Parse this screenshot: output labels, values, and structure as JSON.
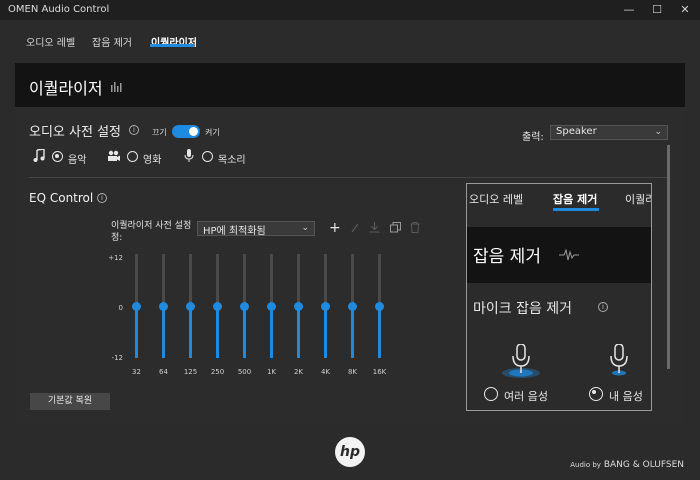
{
  "window": {
    "title": "OMEN Audio Control",
    "min": "—",
    "max": "☐",
    "close": "✕"
  },
  "tabs": [
    {
      "label": "오디오 레벨"
    },
    {
      "label": "잡음 제거"
    },
    {
      "label": "이퀄라이저"
    }
  ],
  "panel": {
    "title": "이퀄라이저"
  },
  "preset": {
    "title": "오디오 사전 설정",
    "off": "끄기",
    "on": "켜기",
    "modes": [
      {
        "label": "음악",
        "selected": true
      },
      {
        "label": "영화",
        "selected": false
      },
      {
        "label": "목소리",
        "selected": false
      }
    ]
  },
  "output": {
    "label": "출력:",
    "value": "Speaker"
  },
  "eq": {
    "title": "EQ Control",
    "preset_label_1": "이퀄라이저 사전 설정",
    "preset_label_2": "정:",
    "preset_value": "HP에 최적화됨",
    "db_max": "+12",
    "db_mid": "0",
    "db_min": "-12",
    "bands": [
      {
        "freq": "32",
        "gain": 0
      },
      {
        "freq": "64",
        "gain": 0
      },
      {
        "freq": "125",
        "gain": 0
      },
      {
        "freq": "250",
        "gain": 0
      },
      {
        "freq": "500",
        "gain": 0
      },
      {
        "freq": "1K",
        "gain": 0
      },
      {
        "freq": "2K",
        "gain": 0
      },
      {
        "freq": "4K",
        "gain": 0
      },
      {
        "freq": "8K",
        "gain": 0
      },
      {
        "freq": "16K",
        "gain": 0
      }
    ],
    "reset": "기본값 복원"
  },
  "overlay": {
    "tabs": [
      "오디오 레벨",
      "잡음 제거",
      "이퀄라"
    ],
    "title": "잡음 제거",
    "subtitle": "마이크 잡음 제거",
    "options": [
      {
        "label": "여러 음성",
        "selected": false
      },
      {
        "label": "내 음성",
        "selected": true
      }
    ]
  },
  "footer": {
    "logo": "hp",
    "audio_by": "Audio by",
    "brand": "BANG & OLUFSEN"
  },
  "colors": {
    "accent": "#1e8ae0",
    "background": "#2b2b2b",
    "header": "#131313"
  }
}
